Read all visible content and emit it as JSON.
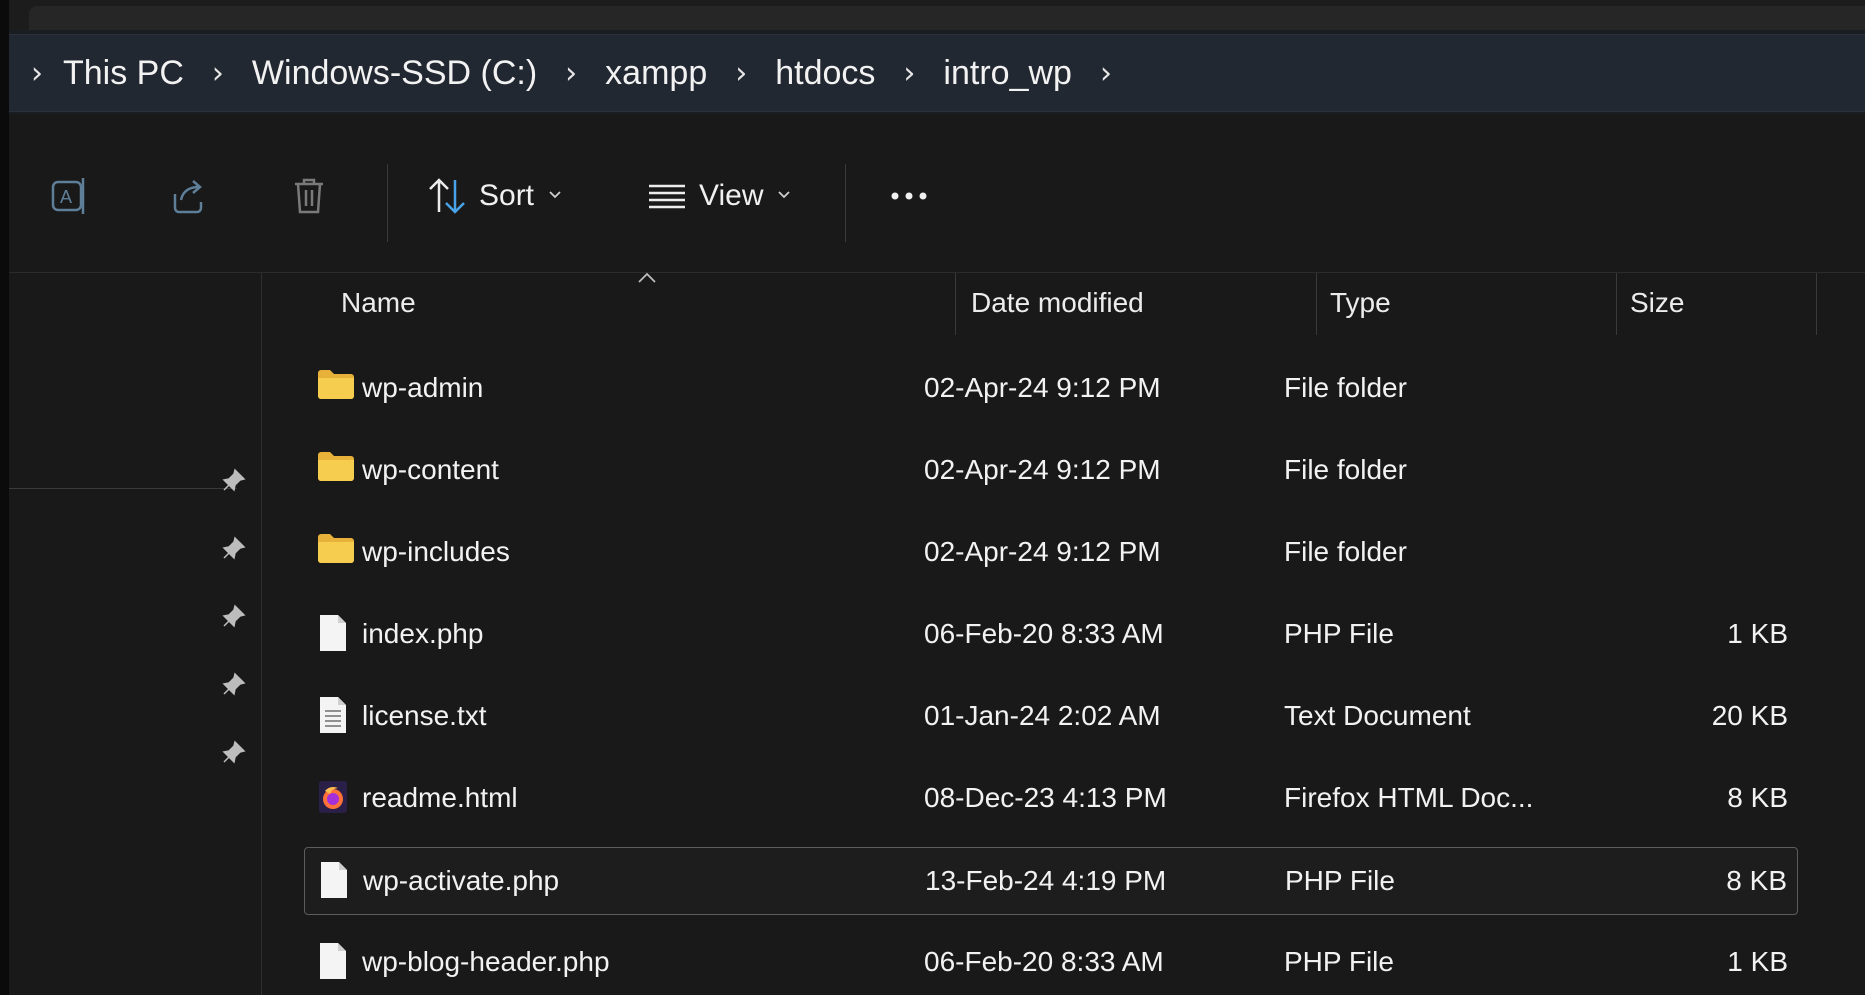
{
  "breadcrumb": {
    "items": [
      "This PC",
      "Windows-SSD (C:)",
      "xampp",
      "htdocs",
      "intro_wp"
    ]
  },
  "toolbar": {
    "rename_icon": "rename-icon",
    "share_icon": "share-icon",
    "delete_icon": "delete-icon",
    "sort_label": "Sort",
    "view_label": "View",
    "more_icon": "more-icon"
  },
  "columns": {
    "name": "Name",
    "date": "Date modified",
    "type": "Type",
    "size": "Size"
  },
  "files": [
    {
      "name": "wp-admin",
      "date": "02-Apr-24 9:12 PM",
      "type": "File folder",
      "size": "",
      "icon": "folder-icon"
    },
    {
      "name": "wp-content",
      "date": "02-Apr-24 9:12 PM",
      "type": "File folder",
      "size": "",
      "icon": "folder-icon"
    },
    {
      "name": "wp-includes",
      "date": "02-Apr-24 9:12 PM",
      "type": "File folder",
      "size": "",
      "icon": "folder-icon"
    },
    {
      "name": "index.php",
      "date": "06-Feb-20 8:33 AM",
      "type": "PHP File",
      "size": "1 KB",
      "icon": "file-icon"
    },
    {
      "name": "license.txt",
      "date": "01-Jan-24 2:02 AM",
      "type": "Text Document",
      "size": "20 KB",
      "icon": "text-file-icon"
    },
    {
      "name": "readme.html",
      "date": "08-Dec-23 4:13 PM",
      "type": "Firefox HTML Doc...",
      "size": "8 KB",
      "icon": "firefox-html-icon"
    },
    {
      "name": "wp-activate.php",
      "date": "13-Feb-24 4:19 PM",
      "type": "PHP File",
      "size": "8 KB",
      "icon": "file-icon",
      "selected": true
    },
    {
      "name": "wp-blog-header.php",
      "date": "06-Feb-20 8:33 AM",
      "type": "PHP File",
      "size": "1 KB",
      "icon": "file-icon"
    }
  ],
  "colors": {
    "background": "#191919",
    "address_bar": "#222831",
    "folder": "#f4c542",
    "accent_blue": "#4aa3e8"
  }
}
